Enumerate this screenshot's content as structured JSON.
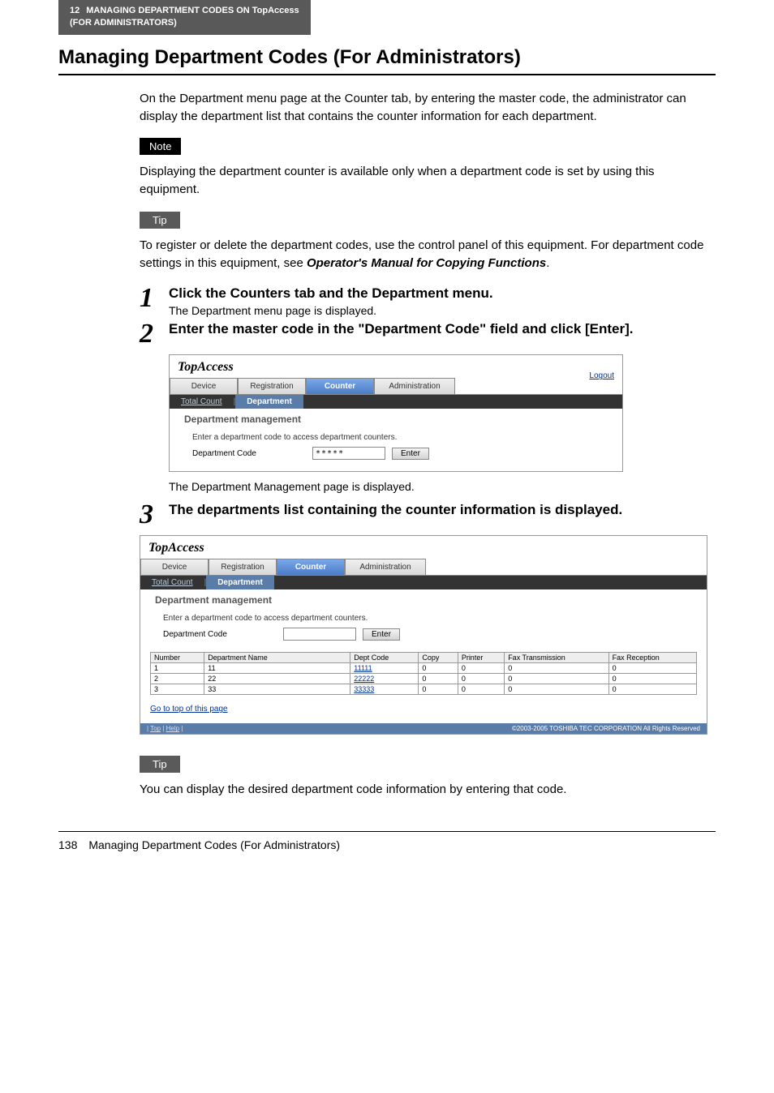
{
  "breadcrumb": {
    "chapter_num": "12",
    "chapter_title": "MANAGING DEPARTMENT CODES ON TopAccess",
    "chapter_sub": "(FOR ADMINISTRATORS)"
  },
  "heading": "Managing Department Codes (For Administrators)",
  "intro": "On the Department menu page at the Counter tab, by entering the master code, the administrator can display the department list that contains the counter information for each department.",
  "note_label": "Note",
  "note_text": "Displaying the department counter is available only when a department code is set by using this equipment.",
  "tip1_label": "Tip",
  "tip1_text_pre": "To register or delete the department codes, use the control panel of this equipment. For department code settings in this equipment, see ",
  "tip1_text_bold": "Operator's Manual for Copying Functions",
  "tip1_text_post": ".",
  "steps": {
    "s1": {
      "num": "1",
      "title": "Click the Counters tab and the Department menu.",
      "sub": "The Department menu page is displayed."
    },
    "s2": {
      "num": "2",
      "title": "Enter the master code in the \"Department Code\" field and click [Enter]."
    },
    "s2_after": "The Department Management page is displayed.",
    "s3": {
      "num": "3",
      "title": "The departments list containing the counter information is displayed."
    }
  },
  "ss": {
    "logo": "TopAccess",
    "logout": "Logout",
    "tabs": {
      "device": "Device",
      "registration": "Registration",
      "counter": "Counter",
      "admin": "Administration"
    },
    "subtabs": {
      "total": "Total Count",
      "sep": "|",
      "dept": "Department"
    },
    "section_title": "Department management",
    "instruction": "Enter a department code to access department counters.",
    "form": {
      "label": "Department Code",
      "value": "*****",
      "btn": "Enter"
    },
    "table": {
      "headers": {
        "num": "Number",
        "name": "Department Name",
        "code": "Dept Code",
        "copy": "Copy",
        "printer": "Printer",
        "faxt": "Fax Transmission",
        "faxr": "Fax Reception"
      },
      "rows": [
        {
          "num": "1",
          "name": "11",
          "code": "11111",
          "copy": "0",
          "printer": "0",
          "faxt": "0",
          "faxr": "0"
        },
        {
          "num": "2",
          "name": "22",
          "code": "22222",
          "copy": "0",
          "printer": "0",
          "faxt": "0",
          "faxr": "0"
        },
        {
          "num": "3",
          "name": "33",
          "code": "33333",
          "copy": "0",
          "printer": "0",
          "faxt": "0",
          "faxr": "0"
        }
      ]
    },
    "gototop": "Go to top of this page",
    "footer_links": {
      "top": "Top",
      "help": "Help",
      "sep": " | "
    },
    "footer_copy": "©2003-2005 TOSHIBA TEC CORPORATION All Rights Reserved"
  },
  "tip2_label": "Tip",
  "tip2_text": "You can display the desired department code information by entering that code.",
  "footer": {
    "pagenum": "138",
    "title": "Managing Department Codes (For Administrators)"
  }
}
